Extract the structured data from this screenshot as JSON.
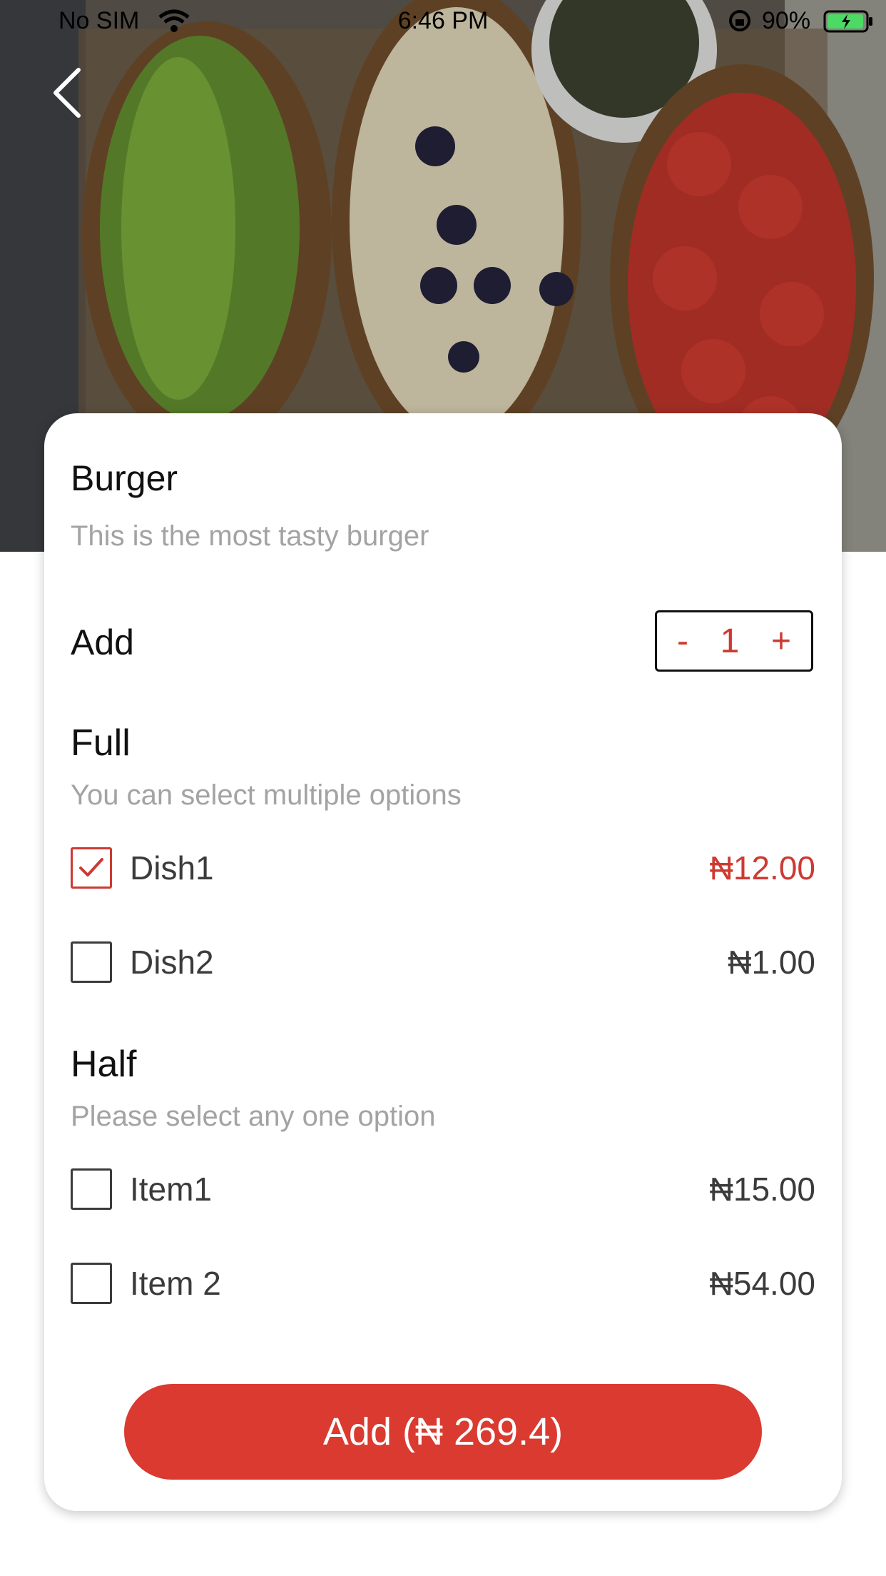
{
  "status_bar": {
    "carrier": "No SIM",
    "time": "6:46 PM",
    "battery": "90%"
  },
  "hero": {
    "icon": "food-photo"
  },
  "product": {
    "name": "Burger",
    "description": "This is the most tasty burger"
  },
  "quantity": {
    "label": "Add",
    "minus": "-",
    "value": "1",
    "plus": "+"
  },
  "sections": [
    {
      "title": "Full",
      "hint": "You can select multiple options",
      "options": [
        {
          "label": "Dish1",
          "price": "₦12.00",
          "checked": true
        },
        {
          "label": "Dish2",
          "price": "₦1.00",
          "checked": false
        }
      ]
    },
    {
      "title": "Half",
      "hint": "Please select any one option",
      "options": [
        {
          "label": "Item1",
          "price": "₦15.00",
          "checked": false
        },
        {
          "label": "Item 2",
          "price": "₦54.00",
          "checked": false
        }
      ]
    }
  ],
  "cta": {
    "label": "Add (₦ 269.4)"
  },
  "colors": {
    "accent": "#da3a2f",
    "price_selected": "#cd3a32",
    "muted_text": "#a3a3a3",
    "body_text": "#3b3b3b"
  }
}
